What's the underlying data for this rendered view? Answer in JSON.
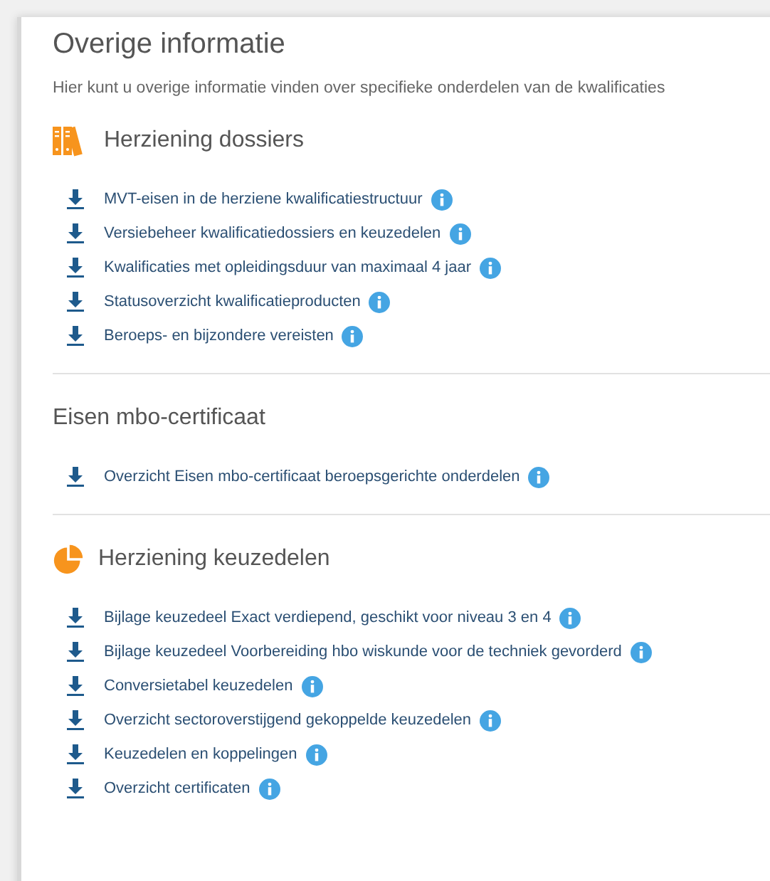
{
  "title": "Overige informatie",
  "intro": "Hier kunt u overige informatie vinden over specifieke onderdelen van de kwalificaties",
  "sections": [
    {
      "kind": "binders",
      "heading": "Herziening dossiers",
      "links": [
        "MVT-eisen in de herziene kwalificatiestructuur",
        "Versiebeheer kwalificatiedossiers en keuzedelen",
        "Kwalificaties met opleidingsduur van maximaal 4 jaar",
        "Statusoverzicht kwalificatieproducten",
        "Beroeps- en bijzondere vereisten"
      ]
    },
    {
      "kind": "plain",
      "heading": "Eisen mbo-certificaat",
      "links": [
        "Overzicht Eisen mbo-certificaat beroepsgerichte onderdelen"
      ]
    },
    {
      "kind": "pie",
      "heading": "Herziening keuzedelen",
      "links": [
        "Bijlage keuzedeel Exact verdiepend, geschikt voor niveau 3 en 4",
        "Bijlage keuzedeel Voorbereiding hbo wiskunde voor de techniek gevorderd",
        "Conversietabel keuzedelen",
        "Overzicht sectoroverstijgend gekoppelde keuzedelen",
        "Keuzedelen en koppelingen",
        "Overzicht certificaten"
      ]
    }
  ]
}
